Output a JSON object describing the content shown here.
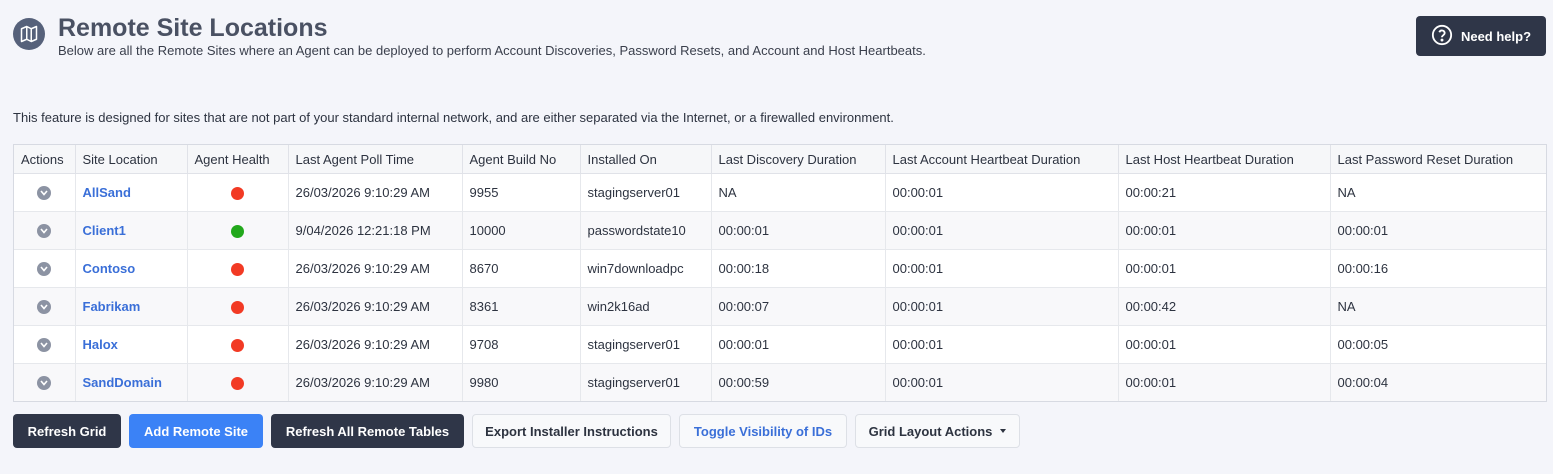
{
  "header": {
    "title": "Remote Site Locations",
    "subtitle": "Below are all the Remote Sites where an Agent can be deployed to perform Account Discoveries, Password Resets, and Account and Host Heartbeats.",
    "icon": "map-icon"
  },
  "help_button": {
    "label": "Need help?",
    "icon": "question-circle-icon"
  },
  "feature_note": "This feature is designed for sites that are not part of your standard internal network, and are either separated via the Internet, or a firewalled environment.",
  "grid": {
    "columns": [
      "Actions",
      "Site Location",
      "Agent Health",
      "Last Agent Poll Time",
      "Agent Build No",
      "Installed On",
      "Last Discovery Duration",
      "Last Account Heartbeat Duration",
      "Last Host Heartbeat Duration",
      "Last Password Reset Duration"
    ],
    "rows": [
      {
        "site": "AllSand",
        "health": "red",
        "poll": "26/03/2026 9:10:29 AM",
        "build": "9955",
        "installed": "stagingserver01",
        "discovery": "NA",
        "account_hb": "00:00:01",
        "host_hb": "00:00:21",
        "reset": "NA"
      },
      {
        "site": "Client1",
        "health": "green",
        "poll": "9/04/2026 12:21:18 PM",
        "build": "10000",
        "installed": "passwordstate10",
        "discovery": "00:00:01",
        "account_hb": "00:00:01",
        "host_hb": "00:00:01",
        "reset": "00:00:01"
      },
      {
        "site": "Contoso",
        "health": "red",
        "poll": "26/03/2026 9:10:29 AM",
        "build": "8670",
        "installed": "win7downloadpc",
        "discovery": "00:00:18",
        "account_hb": "00:00:01",
        "host_hb": "00:00:01",
        "reset": "00:00:16"
      },
      {
        "site": "Fabrikam",
        "health": "red",
        "poll": "26/03/2026 9:10:29 AM",
        "build": "8361",
        "installed": "win2k16ad",
        "discovery": "00:00:07",
        "account_hb": "00:00:01",
        "host_hb": "00:00:42",
        "reset": "NA"
      },
      {
        "site": "Halox",
        "health": "red",
        "poll": "26/03/2026 9:10:29 AM",
        "build": "9708",
        "installed": "stagingserver01",
        "discovery": "00:00:01",
        "account_hb": "00:00:01",
        "host_hb": "00:00:01",
        "reset": "00:00:05"
      },
      {
        "site": "SandDomain",
        "health": "red",
        "poll": "26/03/2026 9:10:29 AM",
        "build": "9980",
        "installed": "stagingserver01",
        "discovery": "00:00:59",
        "account_hb": "00:00:01",
        "host_hb": "00:00:01",
        "reset": "00:00:04"
      }
    ]
  },
  "buttons": {
    "refresh_grid": "Refresh Grid",
    "add_remote_site": "Add Remote Site",
    "refresh_all": "Refresh All Remote Tables",
    "export_instructions": "Export Installer Instructions",
    "toggle_ids": "Toggle Visibility of IDs",
    "grid_layout": "Grid Layout Actions"
  },
  "colors": {
    "health_red": "#f23a24",
    "health_green": "#22a81c",
    "link": "#3a6fd8",
    "dark_button": "#2f3648",
    "primary_button": "#3b82f6"
  }
}
